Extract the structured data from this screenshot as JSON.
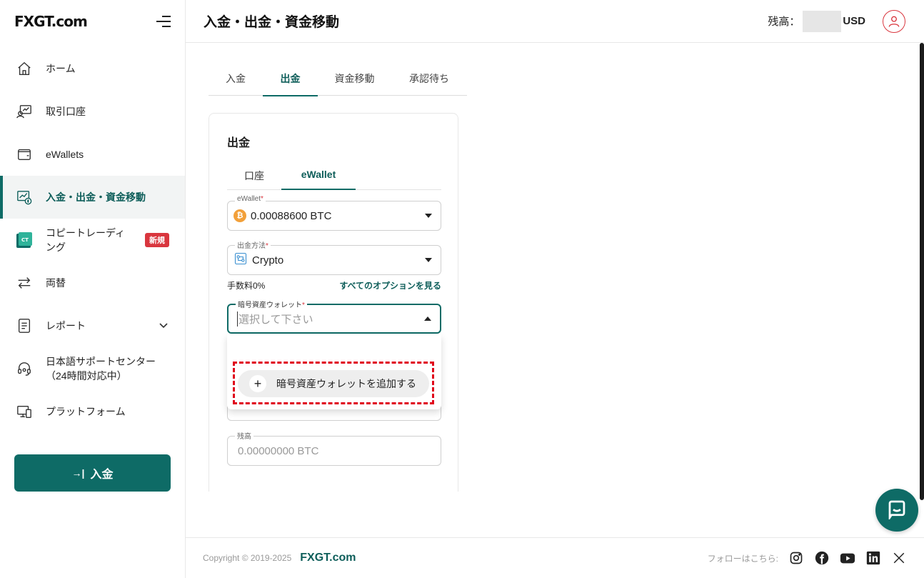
{
  "logo": "FXGT.com",
  "header": {
    "title": "入金・出金・資金移動",
    "balance_label": "残高：",
    "currency": "USD"
  },
  "sidebar": {
    "items": [
      {
        "label": "ホーム",
        "icon": "home-icon"
      },
      {
        "label": "取引口座",
        "icon": "trading-account-icon"
      },
      {
        "label": "eWallets",
        "icon": "wallet-icon"
      },
      {
        "label": "入金・出金・資金移動",
        "icon": "money-transfer-icon"
      },
      {
        "label": "コピートレーディング",
        "icon": "copy-trading-icon",
        "badge": "新規"
      },
      {
        "label": "両替",
        "icon": "exchange-icon"
      },
      {
        "label": "レポート",
        "icon": "report-icon"
      },
      {
        "label": "日本語サポートセンター（24時間対応中）",
        "icon": "headset-icon"
      },
      {
        "label": "プラットフォーム",
        "icon": "platform-icon"
      }
    ],
    "deposit_button": "入金"
  },
  "tabs": [
    "入金",
    "出金",
    "資金移動",
    "承認待ち"
  ],
  "card": {
    "title": "出金",
    "subtabs": [
      "口座",
      "eWallet"
    ],
    "ewallet_field": {
      "label": "eWallet",
      "value": "0.00088600 BTC"
    },
    "method_field": {
      "label": "出金方法",
      "value": "Crypto"
    },
    "fee_text": "手数料0%",
    "all_options_link": "すべてのオプションを見る",
    "crypto_wallet_field": {
      "label": "暗号資産ウォレット",
      "placeholder": "選択して下さい"
    },
    "add_wallet_button": "暗号資産ウォレットを追加する",
    "balance_field": {
      "label": "残高",
      "value": "0.00000000 BTC"
    }
  },
  "footer": {
    "copyright": "Copyright © 2019-2025",
    "brand": "FXGT.com",
    "follow": "フォローはこちら:",
    "social": [
      "instagram-icon",
      "facebook-icon",
      "youtube-icon",
      "linkedin-icon",
      "x-icon"
    ]
  },
  "colors": {
    "accent": "#0e6b66",
    "danger": "#d9363e",
    "highlight": "#e0001a"
  }
}
